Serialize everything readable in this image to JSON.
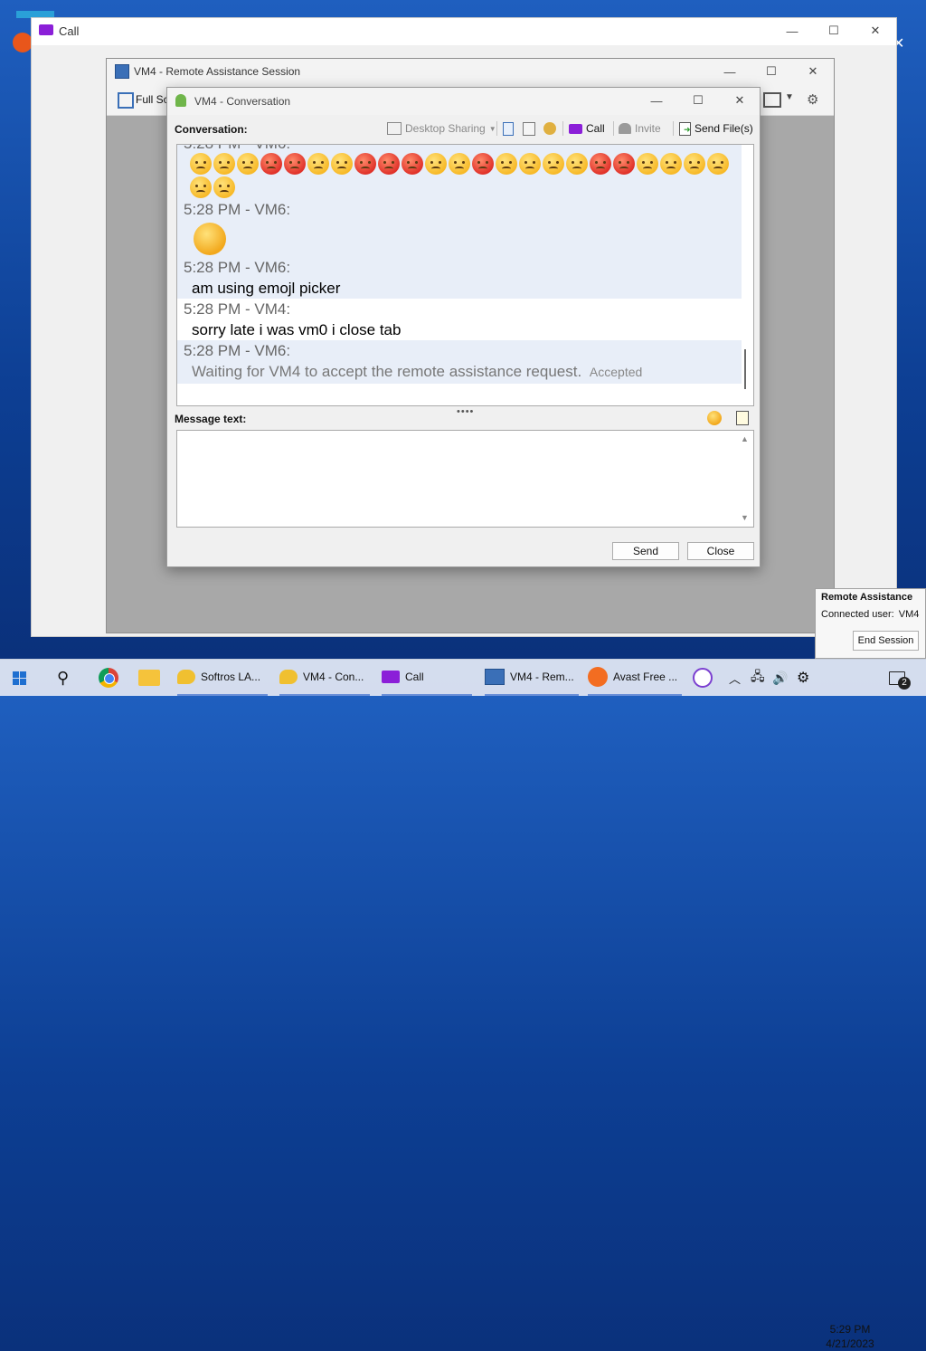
{
  "call_window": {
    "title": "Call"
  },
  "ra_window": {
    "title": "VM4 - Remote Assistance Session",
    "toolbar": {
      "full_screen_label": "Full Sc"
    }
  },
  "conversation_window": {
    "title": "VM4 - Conversation",
    "conversation_label": "Conversation:",
    "toolbar": {
      "desktop_sharing": "Desktop Sharing",
      "call": "Call",
      "invite": "Invite",
      "send_files": "Send File(s)"
    },
    "messages": [
      {
        "timestamp": "5:28 PM - VM6:",
        "text": "am using emojl picker"
      },
      {
        "timestamp": "5:28 PM - VM4:",
        "text": "sorry late i was vm0 i close tab"
      },
      {
        "timestamp": "5:28 PM - VM6:",
        "text": "Waiting for VM4 to accept the remote assistance request.",
        "status": "Accepted"
      }
    ],
    "emoji_timestamp": "5:28 PM - VM6:",
    "emoji_line1_partial": "5:28 PM - VM6:",
    "message_label": "Message text:",
    "message_value": "",
    "send_label": "Send",
    "close_label": "Close"
  },
  "notification": {
    "title": "Remote Assistance",
    "connected_label": "Connected user:",
    "connected_user": "VM4",
    "end_session_label": "End Session"
  },
  "taskbar": {
    "items": [
      {
        "label": "Softros LA..."
      },
      {
        "label": "VM4 - Con..."
      },
      {
        "label": "Call"
      },
      {
        "label": "VM4 - Rem..."
      },
      {
        "label": "Avast Free ..."
      }
    ],
    "clock_time": "5:29 PM",
    "clock_date": "4/21/2023",
    "notification_count": "2"
  },
  "colors": {
    "desktop": "#1f5fbf",
    "chat_highlight": "#e8eef8",
    "call_icon": "#8b1fd8",
    "taskbar": "#e1e8f5"
  }
}
